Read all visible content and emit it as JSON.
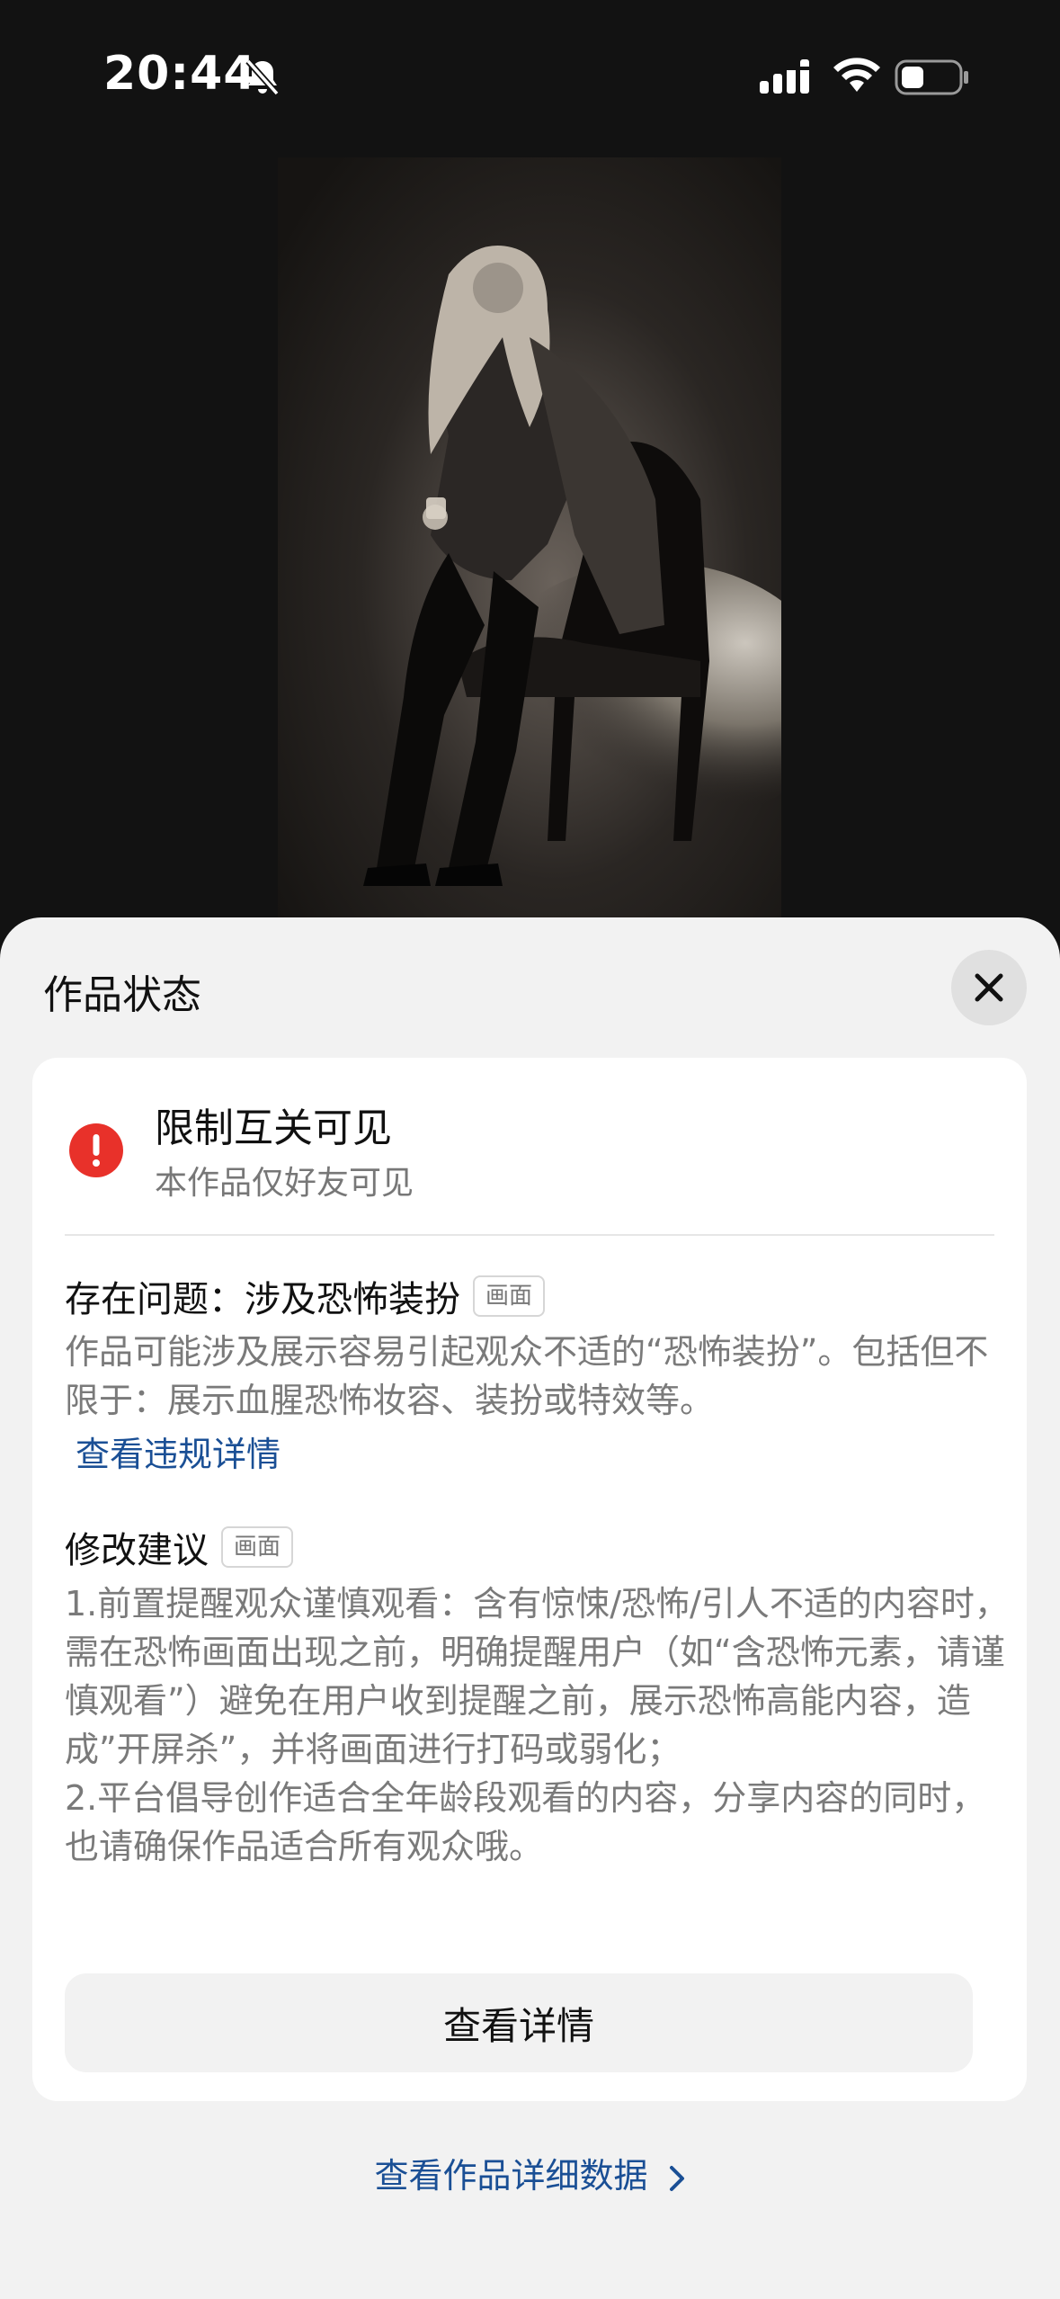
{
  "status_bar": {
    "time": "20:44"
  },
  "sheet": {
    "title": "作品状态",
    "status": {
      "title": "限制互关可见",
      "subtitle": "本作品仅好友可见"
    },
    "issue": {
      "heading": "存在问题：涉及恐怖装扮",
      "tag": "画面",
      "description": "作品可能涉及展示容易引起观众不适的“恐怖装扮”。包括但不限于：展示血腥恐怖妆容、装扮或特效等。",
      "link": "查看违规详情"
    },
    "suggestion": {
      "heading": "修改建议",
      "tag": "画面",
      "items": [
        "1.前置提醒观众谨慎观看：含有惊悚/恐怖/引人不适的内容时，需在恐怖画面出现之前，明确提醒用户（如“含恐怖元素，请谨慎观看”）避免在用户收到提醒之前，展示恐怖高能内容，造成”开屏杀”，并将画面进行打码或弱化；",
        "2.平台倡导创作适合全年龄段观看的内容，分享内容的同时，也请确保作品适合所有观众哦。"
      ]
    },
    "detail_button": "查看详情",
    "data_link": "查看作品详细数据"
  },
  "colors": {
    "alert_red": "#e8312a",
    "link_blue": "#1a4f95",
    "sheet_bg": "#f2f2f2",
    "background": "#121212"
  }
}
